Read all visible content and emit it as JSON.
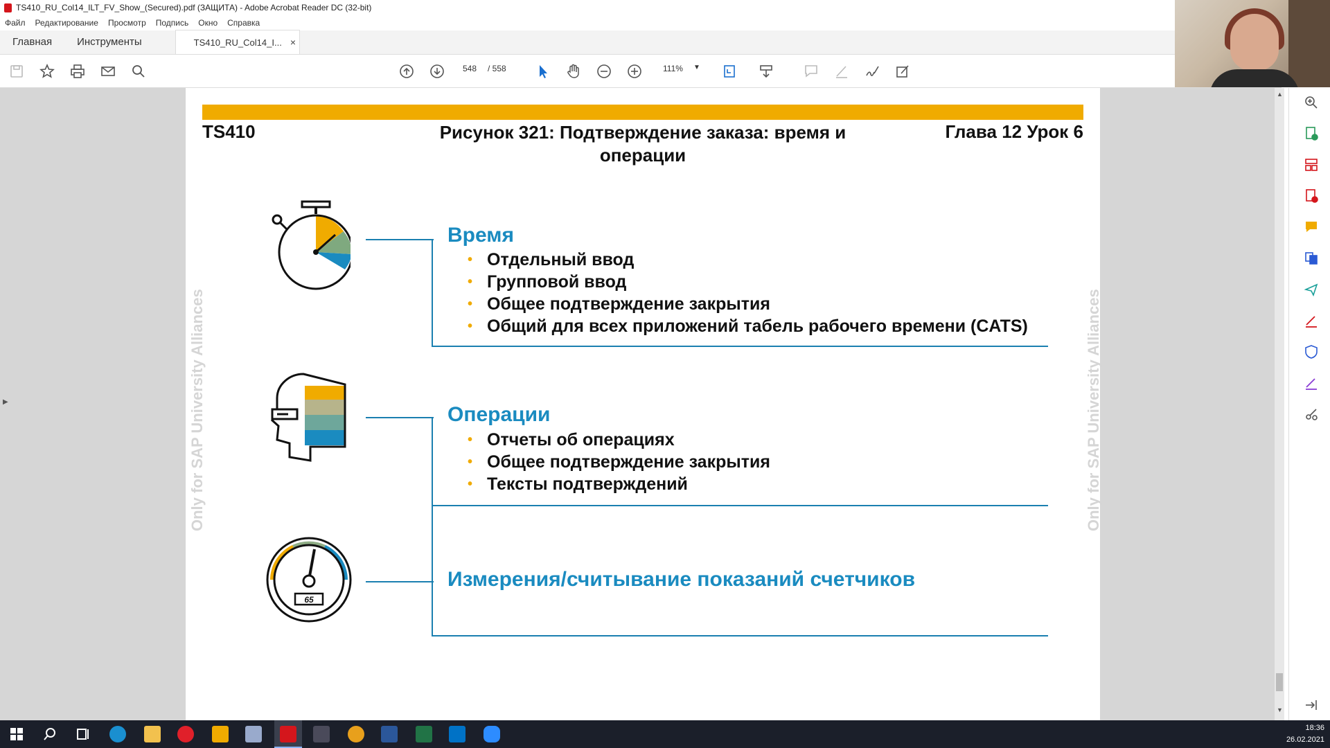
{
  "window": {
    "title": "TS410_RU_Col14_ILT_FV_Show_(Secured).pdf (ЗАЩИТА) - Adobe Acrobat Reader DC (32-bit)"
  },
  "menu": [
    "Файл",
    "Редактирование",
    "Просмотр",
    "Подпись",
    "Окно",
    "Справка"
  ],
  "tabs": {
    "home": "Главная",
    "tools": "Инструменты",
    "document": "TS410_RU_Col14_I...",
    "close": "×"
  },
  "toolbar": {
    "current_page": "548",
    "total_pages": "/ 558",
    "zoom": "111%"
  },
  "slide": {
    "course": "TS410",
    "title_line1": "Рисунок 321: Подтверждение заказа: время и",
    "title_line2": "операции",
    "chapter": "Глава 12 Урок 6",
    "watermark": "Only for SAP University Alliances",
    "sections": [
      {
        "heading": "Время",
        "items": [
          "Отдельный ввод",
          "Групповой ввод",
          "Общее подтверждение закрытия",
          "Общий для всех приложений табель рабочего времени (CATS)"
        ]
      },
      {
        "heading": "Операции",
        "items": [
          "Отчеты об операциях",
          "Общее подтверждение закрытия",
          "Тексты подтверждений"
        ]
      },
      {
        "heading": "Измерения/считывание показаний счетчиков",
        "items": []
      }
    ],
    "gauge_readout": "65"
  },
  "taskbar": {
    "time": "18:36",
    "date": "26.02.2021"
  },
  "colors": {
    "accent_orange": "#f0ab00",
    "heading_blue": "#1a8bc0",
    "line_blue": "#1a7fb0"
  }
}
